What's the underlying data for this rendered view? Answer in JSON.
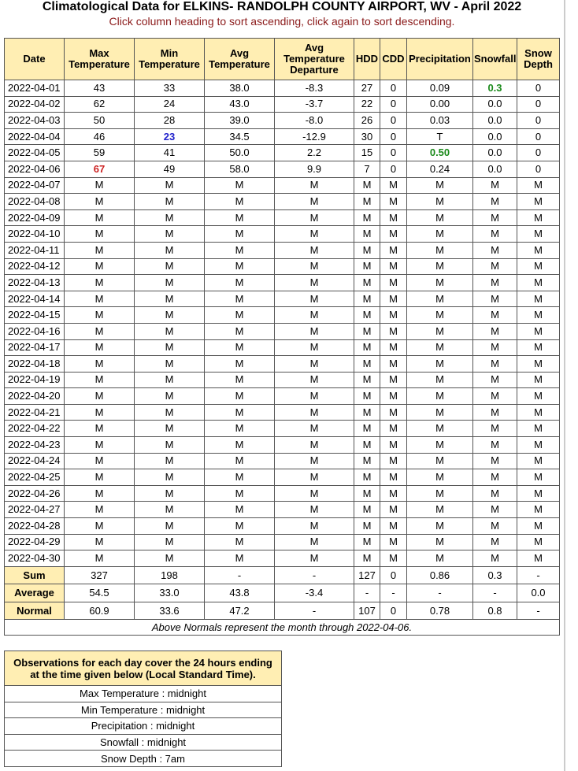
{
  "page": {
    "title": "Climatological Data for ELKINS- RANDOLPH COUNTY AIRPORT, WV - April 2022",
    "subtitle": "Click column heading to sort ascending, click again to sort descending."
  },
  "table": {
    "headers": [
      [
        "Date"
      ],
      [
        "Max",
        "Temperature"
      ],
      [
        "Min",
        "Temperature"
      ],
      [
        "Avg",
        "Temperature"
      ],
      [
        "Avg",
        "Temperature",
        "Departure"
      ],
      [
        "HDD"
      ],
      [
        "CDD"
      ],
      [
        "Precipitation"
      ],
      [
        "Snowfall"
      ],
      [
        "Snow",
        "Depth"
      ]
    ],
    "rows": [
      [
        "2022-04-01",
        "43",
        "33",
        "38.0",
        "-8.3",
        "27",
        "0",
        "0.09",
        "0.3",
        "0"
      ],
      [
        "2022-04-02",
        "62",
        "24",
        "43.0",
        "-3.7",
        "22",
        "0",
        "0.00",
        "0.0",
        "0"
      ],
      [
        "2022-04-03",
        "50",
        "28",
        "39.0",
        "-8.0",
        "26",
        "0",
        "0.03",
        "0.0",
        "0"
      ],
      [
        "2022-04-04",
        "46",
        "23",
        "34.5",
        "-12.9",
        "30",
        "0",
        "T",
        "0.0",
        "0"
      ],
      [
        "2022-04-05",
        "59",
        "41",
        "50.0",
        "2.2",
        "15",
        "0",
        "0.50",
        "0.0",
        "0"
      ],
      [
        "2022-04-06",
        "67",
        "49",
        "58.0",
        "9.9",
        "7",
        "0",
        "0.24",
        "0.0",
        "0"
      ],
      [
        "2022-04-07",
        "M",
        "M",
        "M",
        "M",
        "M",
        "M",
        "M",
        "M",
        "M"
      ],
      [
        "2022-04-08",
        "M",
        "M",
        "M",
        "M",
        "M",
        "M",
        "M",
        "M",
        "M"
      ],
      [
        "2022-04-09",
        "M",
        "M",
        "M",
        "M",
        "M",
        "M",
        "M",
        "M",
        "M"
      ],
      [
        "2022-04-10",
        "M",
        "M",
        "M",
        "M",
        "M",
        "M",
        "M",
        "M",
        "M"
      ],
      [
        "2022-04-11",
        "M",
        "M",
        "M",
        "M",
        "M",
        "M",
        "M",
        "M",
        "M"
      ],
      [
        "2022-04-12",
        "M",
        "M",
        "M",
        "M",
        "M",
        "M",
        "M",
        "M",
        "M"
      ],
      [
        "2022-04-13",
        "M",
        "M",
        "M",
        "M",
        "M",
        "M",
        "M",
        "M",
        "M"
      ],
      [
        "2022-04-14",
        "M",
        "M",
        "M",
        "M",
        "M",
        "M",
        "M",
        "M",
        "M"
      ],
      [
        "2022-04-15",
        "M",
        "M",
        "M",
        "M",
        "M",
        "M",
        "M",
        "M",
        "M"
      ],
      [
        "2022-04-16",
        "M",
        "M",
        "M",
        "M",
        "M",
        "M",
        "M",
        "M",
        "M"
      ],
      [
        "2022-04-17",
        "M",
        "M",
        "M",
        "M",
        "M",
        "M",
        "M",
        "M",
        "M"
      ],
      [
        "2022-04-18",
        "M",
        "M",
        "M",
        "M",
        "M",
        "M",
        "M",
        "M",
        "M"
      ],
      [
        "2022-04-19",
        "M",
        "M",
        "M",
        "M",
        "M",
        "M",
        "M",
        "M",
        "M"
      ],
      [
        "2022-04-20",
        "M",
        "M",
        "M",
        "M",
        "M",
        "M",
        "M",
        "M",
        "M"
      ],
      [
        "2022-04-21",
        "M",
        "M",
        "M",
        "M",
        "M",
        "M",
        "M",
        "M",
        "M"
      ],
      [
        "2022-04-22",
        "M",
        "M",
        "M",
        "M",
        "M",
        "M",
        "M",
        "M",
        "M"
      ],
      [
        "2022-04-23",
        "M",
        "M",
        "M",
        "M",
        "M",
        "M",
        "M",
        "M",
        "M"
      ],
      [
        "2022-04-24",
        "M",
        "M",
        "M",
        "M",
        "M",
        "M",
        "M",
        "M",
        "M"
      ],
      [
        "2022-04-25",
        "M",
        "M",
        "M",
        "M",
        "M",
        "M",
        "M",
        "M",
        "M"
      ],
      [
        "2022-04-26",
        "M",
        "M",
        "M",
        "M",
        "M",
        "M",
        "M",
        "M",
        "M"
      ],
      [
        "2022-04-27",
        "M",
        "M",
        "M",
        "M",
        "M",
        "M",
        "M",
        "M",
        "M"
      ],
      [
        "2022-04-28",
        "M",
        "M",
        "M",
        "M",
        "M",
        "M",
        "M",
        "M",
        "M"
      ],
      [
        "2022-04-29",
        "M",
        "M",
        "M",
        "M",
        "M",
        "M",
        "M",
        "M",
        "M"
      ],
      [
        "2022-04-30",
        "M",
        "M",
        "M",
        "M",
        "M",
        "M",
        "M",
        "M",
        "M"
      ]
    ],
    "highlights": [
      {
        "row": 0,
        "col": 8,
        "color": "#1a8a1a"
      },
      {
        "row": 3,
        "col": 2,
        "color": "#2222cc"
      },
      {
        "row": 4,
        "col": 7,
        "color": "#1a8a1a"
      },
      {
        "row": 5,
        "col": 1,
        "color": "#cc2222"
      }
    ],
    "summary": [
      [
        "Sum",
        "327",
        "198",
        "-",
        "-",
        "127",
        "0",
        "0.86",
        "0.3",
        "-"
      ],
      [
        "Average",
        "54.5",
        "33.0",
        "43.8",
        "-3.4",
        "-",
        "-",
        "-",
        "-",
        "0.0"
      ],
      [
        "Normal",
        "60.9",
        "33.6",
        "47.2",
        "-",
        "107",
        "0",
        "0.78",
        "0.8",
        "-"
      ]
    ],
    "note": "Above Normals represent the month through 2022-04-06."
  },
  "observations": {
    "header": "Observations for each day cover the 24 hours ending at the time given below (Local Standard Time).",
    "items": [
      "Max Temperature : midnight",
      "Min Temperature : midnight",
      "Precipitation : midnight",
      "Snowfall : midnight",
      "Snow Depth : 7am"
    ]
  },
  "colors": {
    "header_bg": "#ffeeb3",
    "subtitle": "#8b1a1a",
    "high_max": "#cc2222",
    "low_min": "#2222cc",
    "max_precip": "#1a8a1a"
  }
}
